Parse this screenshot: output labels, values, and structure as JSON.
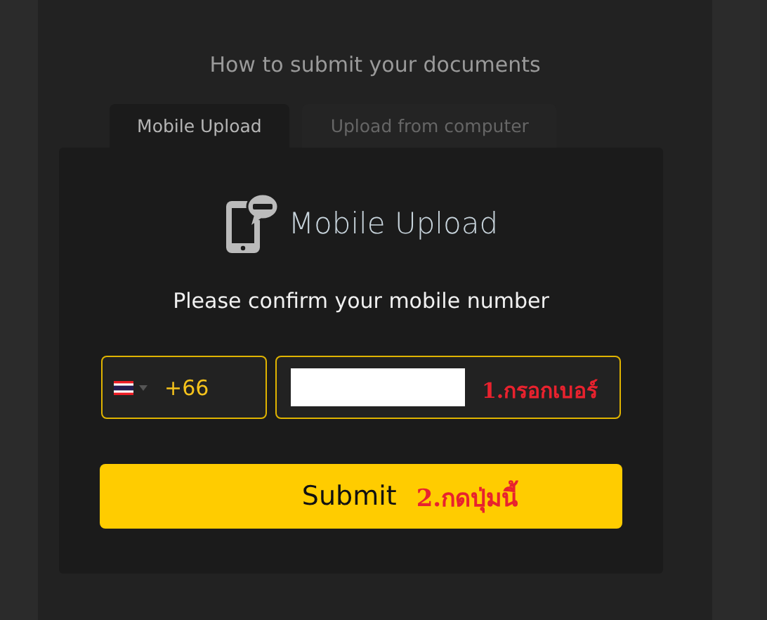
{
  "heading": "How to submit your documents",
  "tabs": [
    {
      "label": "Mobile Upload",
      "selected": true
    },
    {
      "label": "Upload from computer",
      "selected": false
    }
  ],
  "card": {
    "title": "Mobile Upload",
    "prompt": "Please confirm your mobile number",
    "country_code": "+66",
    "phone_redacted": true,
    "phone_note": "1.กรอกเบอร์",
    "submit": "Submit",
    "submit_note": "2.กดปุ่มนี้"
  }
}
